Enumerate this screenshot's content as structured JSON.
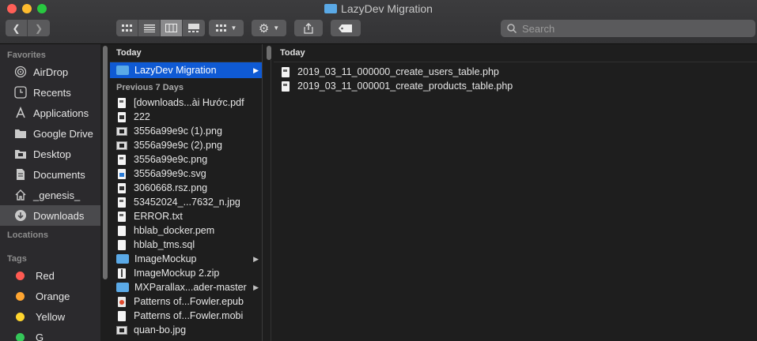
{
  "window": {
    "title": "LazyDev Migration"
  },
  "toolbar": {
    "back_icon": "chevron-left-icon",
    "forward_icon": "chevron-right-icon",
    "views": [
      "icon-view",
      "list-view",
      "column-view",
      "gallery-view"
    ],
    "active_view": "column-view",
    "group_icon": "group-grid-icon",
    "action_icon": "gear-icon",
    "share_icon": "share-icon",
    "tag_icon": "tag-icon",
    "search_placeholder": "Search"
  },
  "sidebar": {
    "favorites_label": "Favorites",
    "favorites": [
      {
        "label": "AirDrop",
        "icon": "airdrop-icon"
      },
      {
        "label": "Recents",
        "icon": "recents-icon"
      },
      {
        "label": "Applications",
        "icon": "applications-icon"
      },
      {
        "label": "Google Drive",
        "icon": "folder-icon"
      },
      {
        "label": "Desktop",
        "icon": "desktop-icon"
      },
      {
        "label": "Documents",
        "icon": "documents-icon"
      },
      {
        "label": "_genesis_",
        "icon": "home-icon"
      },
      {
        "label": "Downloads",
        "icon": "downloads-icon",
        "selected": true
      }
    ],
    "locations_label": "Locations",
    "tags_label": "Tags",
    "tags": [
      {
        "label": "Red",
        "color": "#ff5a52"
      },
      {
        "label": "Orange",
        "color": "#ffa531"
      },
      {
        "label": "Yellow",
        "color": "#ffd52e"
      },
      {
        "label": "G",
        "color": "#35c759"
      }
    ]
  },
  "column1": {
    "header": "Today",
    "today_items": [
      {
        "label": "LazyDev Migration",
        "type": "folder",
        "selected": true,
        "has_children": true
      }
    ],
    "group_label": "Previous 7 Days",
    "items": [
      {
        "label": "[downloads...ài Hước.pdf",
        "type": "pdf"
      },
      {
        "label": "222",
        "type": "dark"
      },
      {
        "label": "3556a99e9c (1).png",
        "type": "image"
      },
      {
        "label": "3556a99e9c (2).png",
        "type": "image"
      },
      {
        "label": "3556a99e9c.png",
        "type": "pdf"
      },
      {
        "label": "3556a99e9c.svg",
        "type": "blue"
      },
      {
        "label": "3060668.rsz.png",
        "type": "dark"
      },
      {
        "label": "53452024_...7632_n.jpg",
        "type": "pdf"
      },
      {
        "label": "ERROR.txt",
        "type": "pdf"
      },
      {
        "label": "hblab_docker.pem",
        "type": "doc"
      },
      {
        "label": "hblab_tms.sql",
        "type": "doc"
      },
      {
        "label": "ImageMockup",
        "type": "folder",
        "has_children": true
      },
      {
        "label": "ImageMockup 2.zip",
        "type": "zip"
      },
      {
        "label": "MXParallax...ader-master",
        "type": "folder",
        "has_children": true
      },
      {
        "label": "Patterns of...Fowler.epub",
        "type": "red"
      },
      {
        "label": "Patterns of...Fowler.mobi",
        "type": "doc"
      },
      {
        "label": "quan-bo.jpg",
        "type": "image"
      }
    ]
  },
  "column2": {
    "header": "Today",
    "items": [
      {
        "label": "2019_03_11_000000_create_users_table.php",
        "type": "php"
      },
      {
        "label": "2019_03_11_000001_create_products_table.php",
        "type": "php"
      }
    ]
  }
}
